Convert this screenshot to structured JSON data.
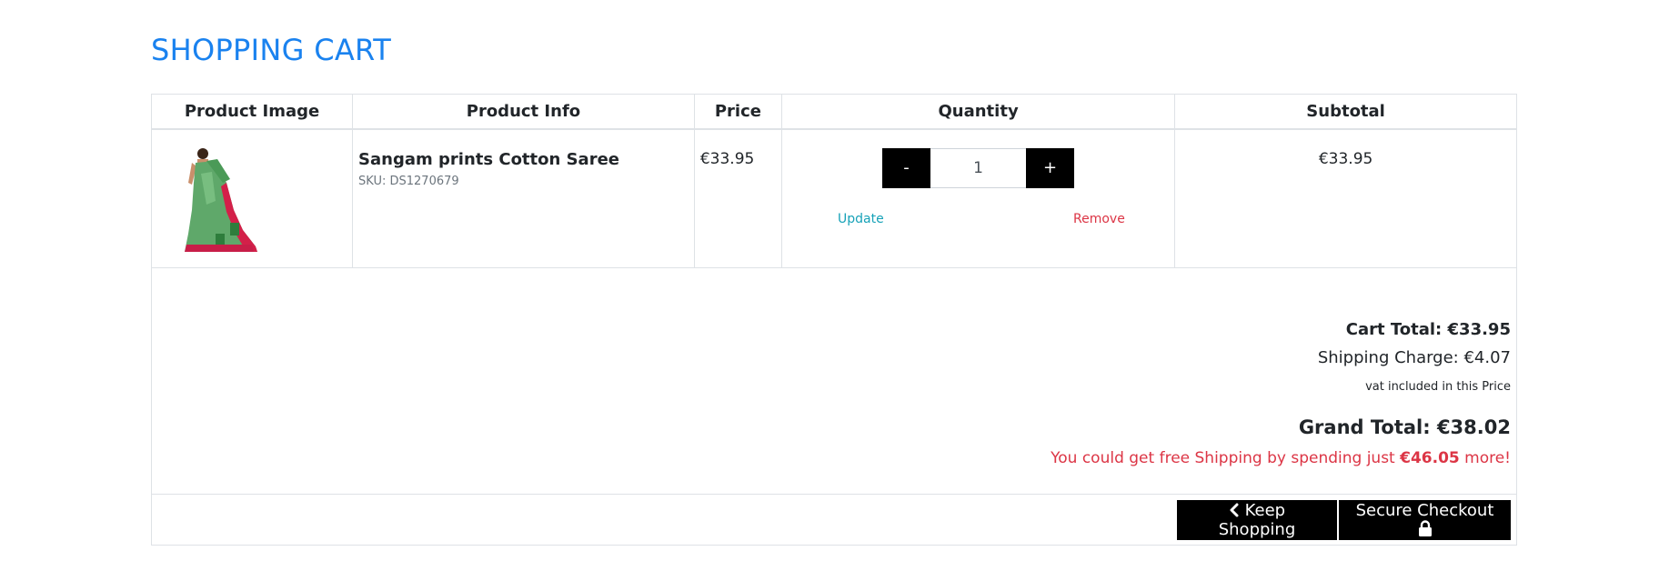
{
  "page": {
    "title": "SHOPPING CART"
  },
  "table": {
    "headers": [
      "Product Image",
      "Product Info",
      "Price",
      "Quantity",
      "Subtotal"
    ]
  },
  "item": {
    "name": "Sangam prints Cotton Saree",
    "sku": "SKU: DS1270679",
    "price": "€33.95",
    "quantity": "1",
    "minus_label": "-",
    "plus_label": "+",
    "update_label": "Update",
    "remove_label": "Remove",
    "subtotal": "€33.95"
  },
  "summary": {
    "cart_total": "Cart Total: €33.95",
    "shipping_charge": "Shipping Charge: €4.07",
    "vat_note": "vat included in this Price",
    "grand_total": "Grand Total: €38.02",
    "free_shipping_prefix": "You could get free Shipping by spending just ",
    "free_shipping_amount": "€46.05",
    "free_shipping_suffix": " more!"
  },
  "actions": {
    "keep_shopping": "Keep Shopping",
    "secure_checkout": "Secure Checkout"
  },
  "colors": {
    "title": "#1a82ef",
    "update_link": "#17a2b8",
    "remove_link": "#dc3545",
    "button_bg": "#000000",
    "free_shipping_text": "#dc3545"
  },
  "icons": {
    "product_image": "saree-product-image",
    "keep_shopping": "chevron-left-icon",
    "secure_checkout": "lock-icon"
  }
}
